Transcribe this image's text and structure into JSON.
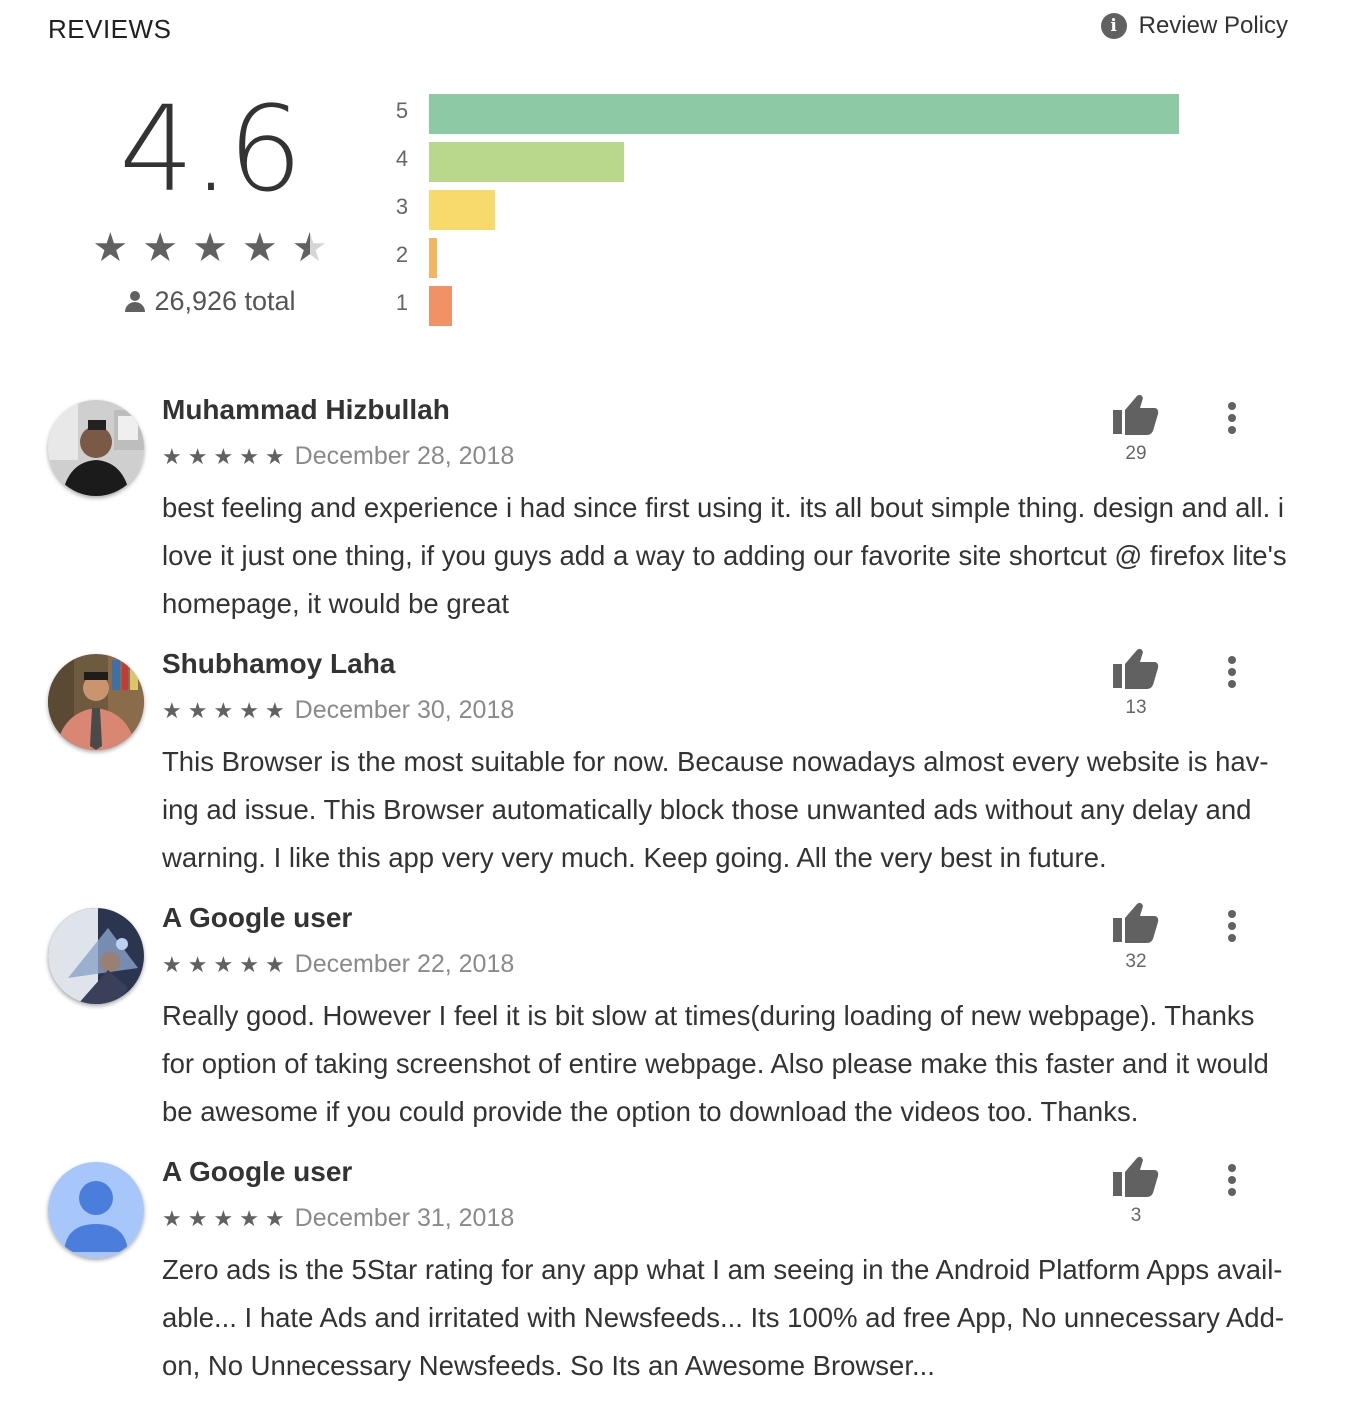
{
  "header": {
    "title": "REVIEWS",
    "policy_label": "Review Policy",
    "policy_icon": "info-icon"
  },
  "summary": {
    "score": "4.6",
    "stars": 4.5,
    "total": "26,926 total"
  },
  "histogram": [
    {
      "label": "5",
      "fraction": 1.0,
      "color": "#8ec9a6"
    },
    {
      "label": "4",
      "fraction": 0.26,
      "color": "#b9d88c"
    },
    {
      "label": "3",
      "fraction": 0.088,
      "color": "#f7da6b"
    },
    {
      "label": "2",
      "fraction": 0.01,
      "color": "#f5b45f"
    },
    {
      "label": "1",
      "fraction": 0.03,
      "color": "#f29066"
    }
  ],
  "reviews": [
    {
      "name": "Muhammad Hizbullah",
      "rating": 5,
      "date": "December 28, 2018",
      "likes": "29",
      "text": "best feeling and experience i had since first using it. its all bout simple thing. design and all. i love it just one thing, if you guys add a way to adding our favorite site shortcut @ firefox lite's homepage, it would be great"
    },
    {
      "name": "Shubhamoy Laha",
      "rating": 5,
      "date": "December 30, 2018",
      "likes": "13",
      "text": "This Browser is the most suitable for now. Because nowadays almost every website is hav-ing ad issue. This Browser automatically block those unwanted ads without any delay and warning. I like this app very very much. Keep going. All the very best in future."
    },
    {
      "name": "A Google user",
      "rating": 5,
      "date": "December 22, 2018",
      "likes": "32",
      "text": "Really good. However I feel it is bit slow at times(during loading of new webpage). Thanks for option of taking screenshot of entire webpage. Also please make this faster and it would be awesome if you could provide the option to download the videos too. Thanks."
    },
    {
      "name": "A Google user",
      "rating": 5,
      "date": "December 31, 2018",
      "likes": "3",
      "text": "Zero ads is the 5Star rating for any app what I am seeing in the Android Platform Apps avail-able... I hate Ads and irritated with Newsfeeds... Its 100% ad free App, No unnecessary Add-on, No Unnecessary Newsfeeds. So Its an Awesome Browser..."
    }
  ]
}
